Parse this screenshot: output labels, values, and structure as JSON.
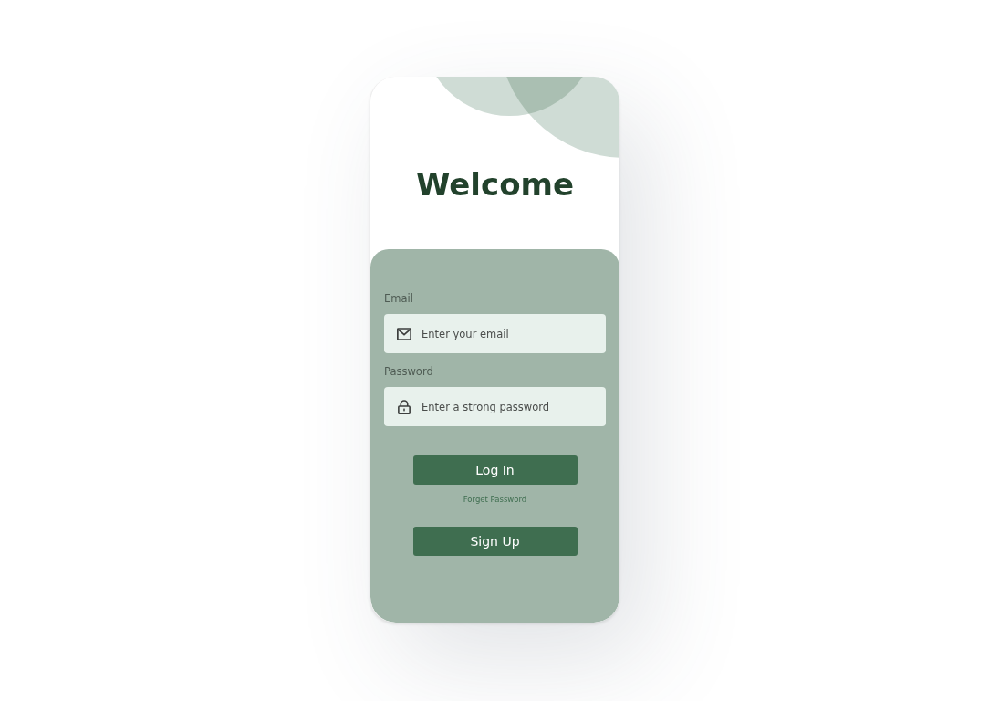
{
  "screen": {
    "title": "Welcome"
  },
  "form": {
    "fields": [
      {
        "kind": "email",
        "label": "Email",
        "placeholder": "Enter your email"
      },
      {
        "kind": "password",
        "label": "Password",
        "placeholder": "Enter a strong password"
      }
    ],
    "login_button": "Log In",
    "forgot_link": "Forget Password",
    "signup_button": "Sign Up"
  }
}
